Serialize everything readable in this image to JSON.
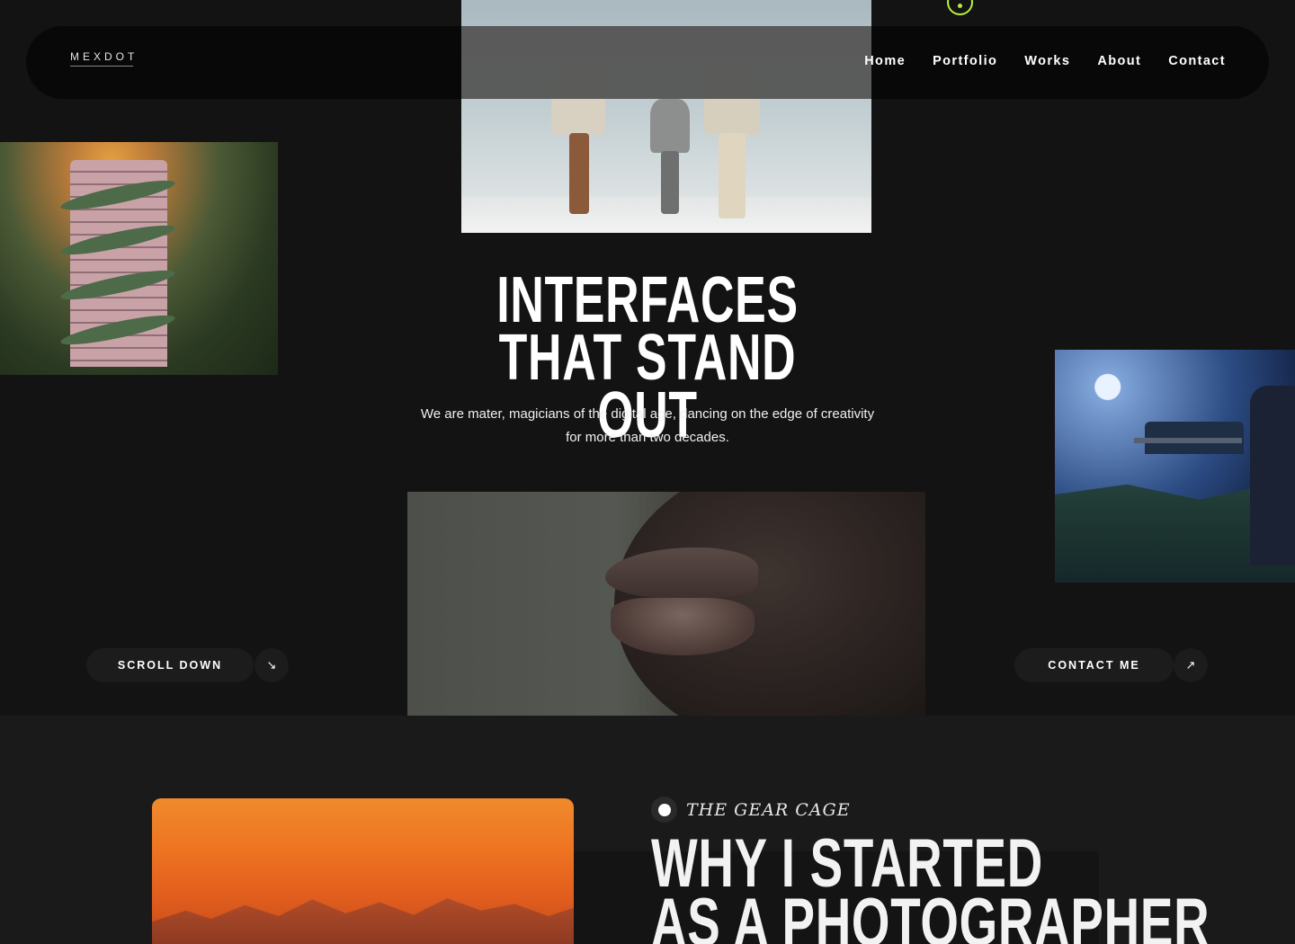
{
  "brand": {
    "logo_text": "MEXDOT"
  },
  "nav": {
    "items": [
      {
        "label": "Home"
      },
      {
        "label": "Portfolio"
      },
      {
        "label": "Works"
      },
      {
        "label": "About"
      },
      {
        "label": "Contact"
      }
    ]
  },
  "hero": {
    "title_line1": "INTERFACES",
    "title_line2": "THAT STAND OUT",
    "subtitle": "We are mater, magicians of the digital age, dancing on the edge of creativity for more than two decades."
  },
  "buttons": {
    "scroll_down": "SCROLL DOWN",
    "scroll_icon": "↘",
    "contact_me": "CONTACT ME",
    "contact_icon": "↗"
  },
  "section_two": {
    "tag": "THE GEAR CAGE",
    "title_line1": "WHY I STARTED",
    "title_line2": "AS A PHOTOGRAPHER"
  },
  "colors": {
    "background": "#131313",
    "accent": "#b6f03c",
    "text": "#ffffff"
  },
  "icons": [
    "arrow-down-right-icon",
    "arrow-up-right-icon",
    "dot-icon"
  ]
}
